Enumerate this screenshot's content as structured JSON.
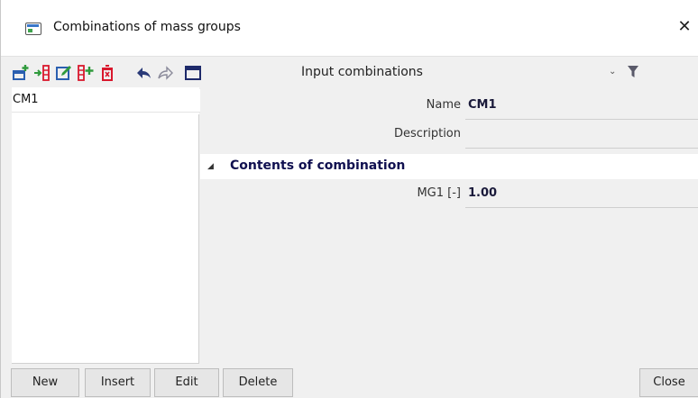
{
  "window": {
    "title": "Combinations of mass groups",
    "close_glyph": "✕"
  },
  "toolbar": {
    "icons": [
      "new-record-icon",
      "insert-record-icon",
      "edit-record-icon",
      "copy-record-icon",
      "delete-record-icon",
      "undo-icon",
      "redo-icon",
      "table-view-icon"
    ],
    "input_label": "Input combinations",
    "chevron_glyph": "⌄",
    "filter_icon": "filter-icon"
  },
  "list": {
    "items": [
      "CM1"
    ]
  },
  "properties": {
    "name_label": "Name",
    "name_value": "CM1",
    "description_label": "Description",
    "description_value": "",
    "group_title": "Contents of combination",
    "group_arrow": "◢",
    "mg1_label": "MG1 [-]",
    "mg1_value": "1.00"
  },
  "buttons": {
    "new": "New",
    "insert": "Insert",
    "edit": "Edit",
    "delete": "Delete",
    "close": "Close"
  },
  "colors": {
    "accent_red": "#d9182d",
    "accent_blue": "#2a5fb0",
    "accent_green": "#2f9a3c",
    "value_text": "#1a1a3a"
  }
}
